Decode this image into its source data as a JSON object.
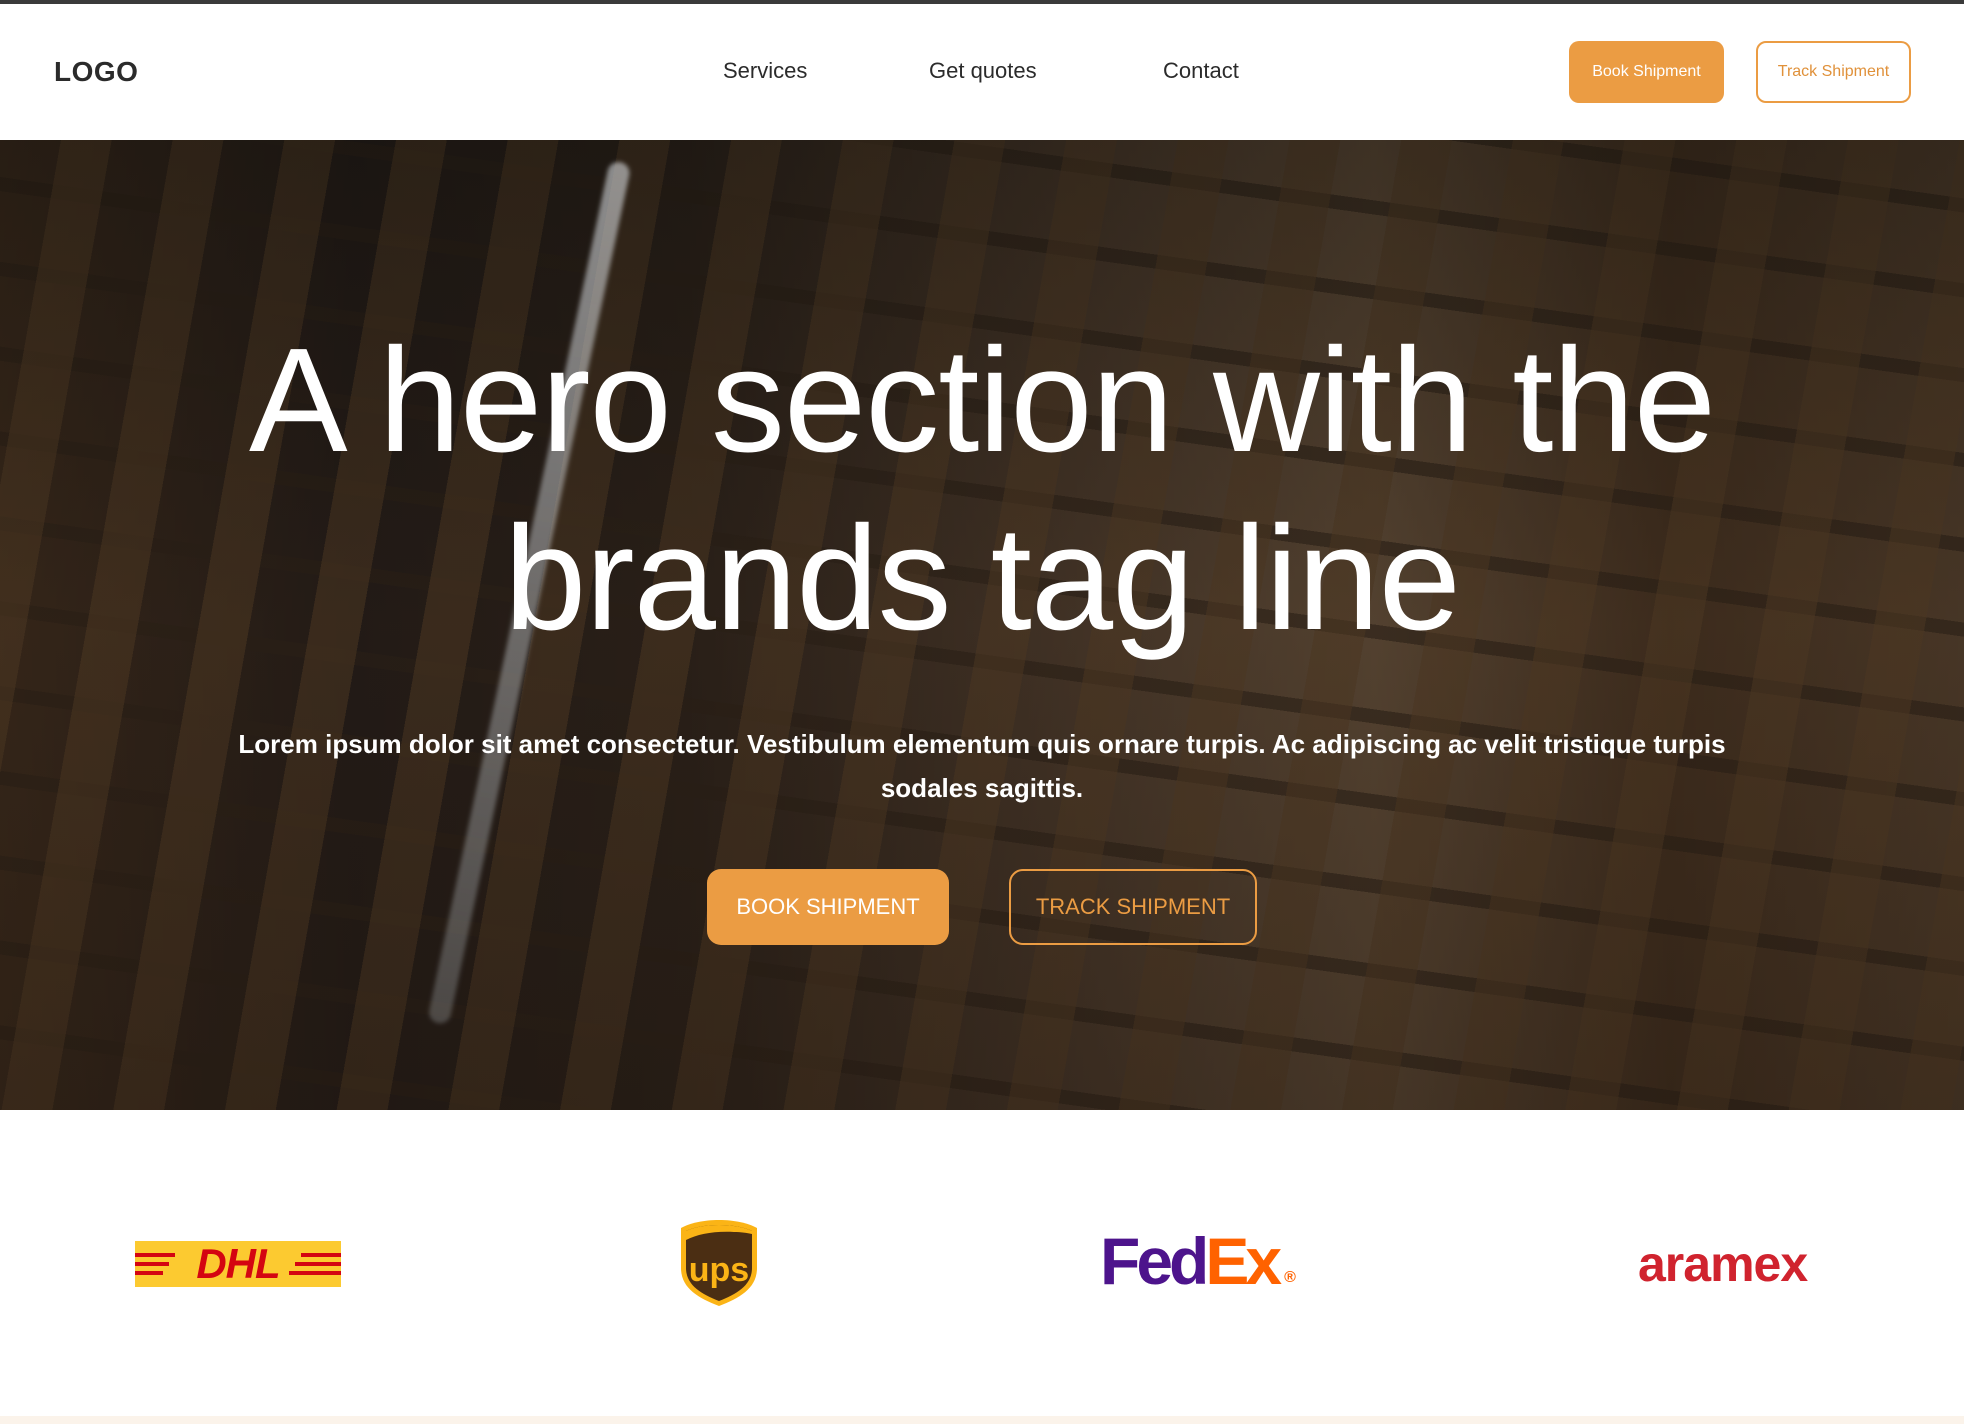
{
  "navbar": {
    "logo": "LOGO",
    "links": [
      "Services",
      "Get quotes",
      "Contact"
    ],
    "book_button": "Book Shipment",
    "track_button": "Track Shipment"
  },
  "hero": {
    "title_line1": "A hero section with the",
    "title_line2": "brands tag line",
    "subtitle": "Lorem ipsum dolor sit amet consectetur. Vestibulum elementum quis ornare turpis. Ac adipiscing ac velit tristique turpis sodales sagittis.",
    "book_button": "BOOK SHIPMENT",
    "track_button": "TRACK SHIPMENT"
  },
  "partners": {
    "dhl": "DHL",
    "ups": "ups",
    "fedex_fed": "Fed",
    "fedex_ex": "Ex",
    "fedex_reg": "®",
    "aramex": "aramex"
  },
  "colors": {
    "accent": "#eb9c43",
    "dhl_yellow": "#fcca30",
    "dhl_red": "#d40511",
    "ups_brown": "#4b2e13",
    "ups_gold": "#fbb416",
    "fedex_purple": "#4d148c",
    "fedex_orange": "#ff6200",
    "aramex_red": "#d0232e"
  }
}
